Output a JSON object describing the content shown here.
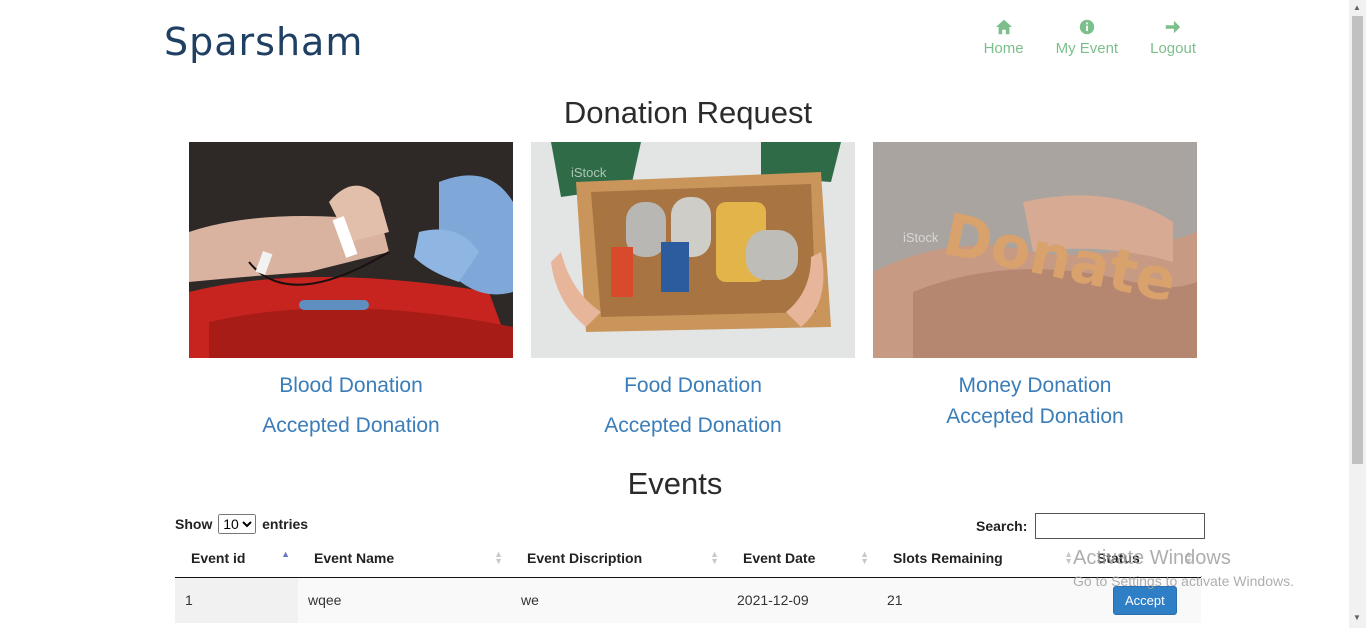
{
  "brand": "Sparsham",
  "nav": {
    "home": "Home",
    "my_event": "My Event",
    "logout": "Logout"
  },
  "page_title": "Donation Request",
  "cards": {
    "blood": {
      "title": "Blood Donation",
      "accepted": "Accepted Donation"
    },
    "food": {
      "title": "Food Donation",
      "accepted": "Accepted Donation",
      "watermark": "iStock"
    },
    "money": {
      "title": "Money Donation",
      "accepted": "Accepted Donation",
      "watermark": "iStock",
      "sign": "Donate"
    }
  },
  "events_title": "Events",
  "table_controls": {
    "show": "Show",
    "entries_value": "10",
    "entries": "entries",
    "search_label": "Search:"
  },
  "table": {
    "columns": [
      "Event id",
      "Event Name",
      "Event Discription",
      "Event Date",
      "Slots Remaining",
      "Status"
    ],
    "rows": [
      {
        "id": "1",
        "name": "wqee",
        "description": "we",
        "date": "2021-12-09",
        "slots": "21",
        "action": "Accept"
      }
    ]
  },
  "watermark": {
    "line1": "Activate Windows",
    "line2": "Go to Settings to activate Windows."
  },
  "colors": {
    "brand": "#1f3f63",
    "nav": "#7dbf8c",
    "link": "#3a7db8",
    "button": "#2f7fc7"
  }
}
